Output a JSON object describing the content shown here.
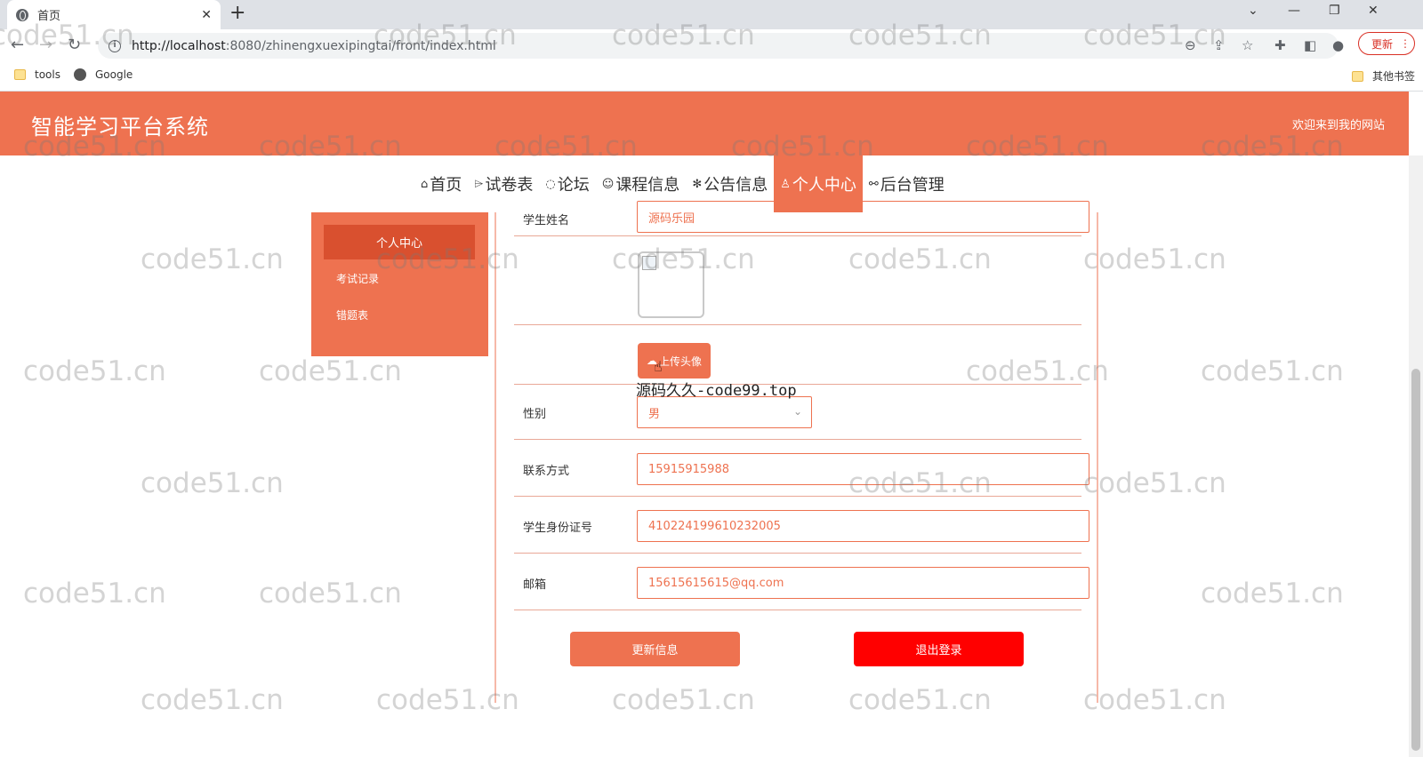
{
  "browser": {
    "tab_title": "首页",
    "tab_close": "✕",
    "new_tab": "+",
    "url_host": "http://localhost",
    "url_rest": ":8080/zhinengxuexipingtai/front/index.html",
    "update_label": "更新",
    "bookmarks": [
      "tools",
      "Google"
    ],
    "other_bookmarks": "其他书签"
  },
  "header": {
    "title": "智能学习平台系统",
    "welcome": "欢迎来到我的网站"
  },
  "nav": {
    "items": [
      {
        "icon": "⌂",
        "label": "首页"
      },
      {
        "icon": "⌲",
        "label": "试卷表"
      },
      {
        "icon": "◌",
        "label": "论坛"
      },
      {
        "icon": "☺",
        "label": "课程信息"
      },
      {
        "icon": "✻",
        "label": "公告信息"
      },
      {
        "icon": "♙",
        "label": "个人中心"
      },
      {
        "icon": "⚯",
        "label": "后台管理"
      }
    ],
    "active_index": 5
  },
  "sidebar": {
    "items": [
      "个人中心",
      "考试记录",
      "错题表"
    ]
  },
  "form": {
    "name_label": "学生姓名",
    "name_value": "源码乐园",
    "upload_label": "上传头像",
    "gender_label": "性别",
    "gender_value": "男",
    "phone_label": "联系方式",
    "phone_value": "15915915988",
    "idcard_label": "学生身份证号",
    "idcard_value": "410224199610232005",
    "email_label": "邮箱",
    "email_value": "15615615615@qq.com",
    "update_button": "更新信息",
    "logout_button": "退出登录"
  },
  "overlay_text": "源码久久-code99.top",
  "watermark": "code51.cn",
  "colors": {
    "brand": "#ee7250",
    "brand_dark": "#d9502f",
    "logout": "#ff0000"
  }
}
